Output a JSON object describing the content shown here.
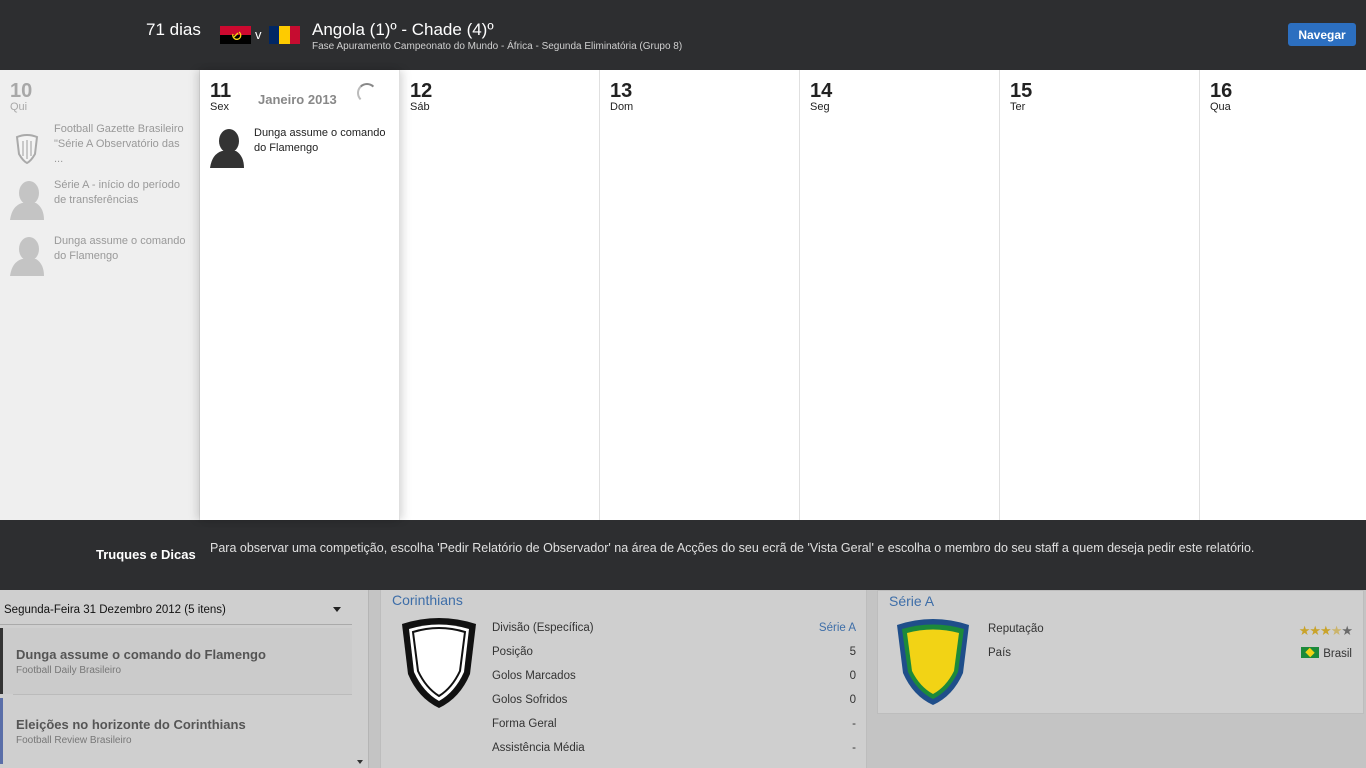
{
  "header": {
    "days": "71 dias",
    "vs": "v",
    "match_title": "Angola (1)º - Chade (4)º",
    "match_subtitle": "Fase Apuramento Campeonato do Mundo - África - Segunda Eliminatória (Grupo 8)",
    "navigate_label": "Navegar",
    "colors": {
      "accent": "#2c6fc0",
      "bar": "#2d2e30"
    }
  },
  "calendar": {
    "month": "Janeiro 2013",
    "days": [
      {
        "num": "10",
        "name": "Qui"
      },
      {
        "num": "11",
        "name": "Sex"
      },
      {
        "num": "12",
        "name": "Sáb"
      },
      {
        "num": "13",
        "name": "Dom"
      },
      {
        "num": "14",
        "name": "Seg"
      },
      {
        "num": "15",
        "name": "Ter"
      },
      {
        "num": "16",
        "name": "Qua"
      }
    ],
    "past_news": [
      {
        "text": "Football Gazette Brasileiro \"Série A Observatório das ...",
        "icon": "shield-icon"
      },
      {
        "text": "Série A - início do período de transferências",
        "icon": "person-silhouette-icon"
      },
      {
        "text": "Dunga assume o comando do Flamengo",
        "icon": "person-silhouette-icon"
      }
    ],
    "current_news": [
      {
        "text": "Dunga assume o comando do Flamengo",
        "icon": "person-silhouette-icon"
      }
    ]
  },
  "tips": {
    "label": "Truques e Dicas",
    "text": "Para observar uma competição, escolha 'Pedir Relatório de Observador' na área de Acções do seu ecrã de 'Vista Geral' e escolha o membro do seu staff a quem deseja pedir este relatório."
  },
  "news_panel": {
    "header": "Segunda-Feira 31 Dezembro 2012 (5 itens)",
    "items": [
      {
        "headline": "Dunga assume o comando do Flamengo",
        "source": "Football Daily Brasileiro"
      },
      {
        "headline": "Eleições no horizonte do Corinthians",
        "source": "Football Review Brasileiro"
      }
    ]
  },
  "club_panel": {
    "title": "Corinthians",
    "rows": [
      {
        "label": "Divisão (Específica)",
        "value": "Série A"
      },
      {
        "label": "Posição",
        "value": "5"
      },
      {
        "label": "Golos Marcados",
        "value": "0"
      },
      {
        "label": "Golos Sofridos",
        "value": "0"
      },
      {
        "label": "Forma Geral",
        "value": "-"
      },
      {
        "label": "Assistência Média",
        "value": "-"
      }
    ]
  },
  "league_panel": {
    "title": "Série A",
    "reputation_label": "Reputação",
    "reputation_stars": 3.5,
    "country_label": "País",
    "country_value": "Brasil"
  }
}
